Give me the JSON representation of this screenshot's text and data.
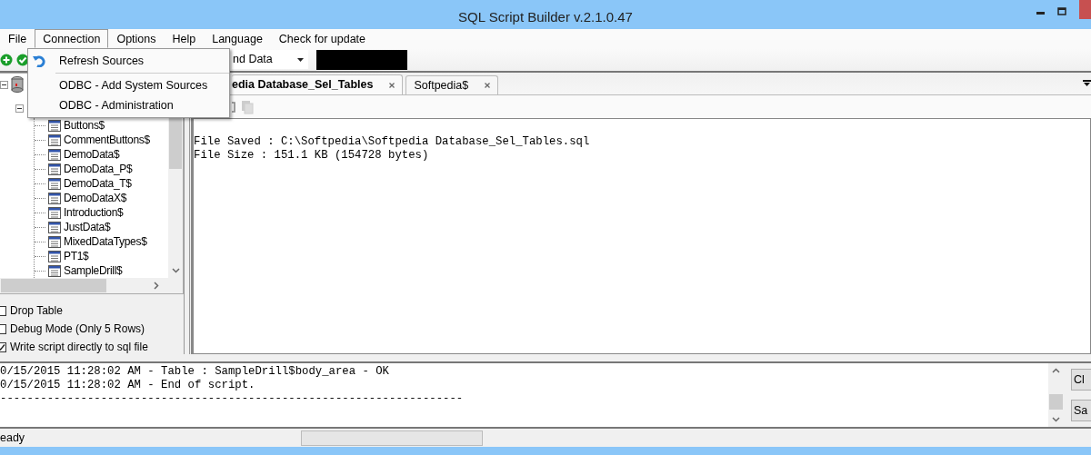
{
  "window": {
    "title": "SQL Script Builder v.2.1.0.47"
  },
  "menu": [
    {
      "label": "File",
      "selected": false
    },
    {
      "label": "Connection",
      "selected": true
    },
    {
      "label": "Options",
      "selected": false
    },
    {
      "label": "Help",
      "selected": false
    },
    {
      "label": "Language",
      "selected": false
    },
    {
      "label": "Check for update",
      "selected": false
    }
  ],
  "connection_menu": [
    {
      "kind": "icon_item",
      "label": "Refresh Sources"
    },
    {
      "kind": "separator"
    },
    {
      "kind": "item",
      "label": "ODBC - Add System Sources"
    },
    {
      "kind": "item",
      "label": "ODBC - Administration"
    }
  ],
  "toolbar": {
    "combo_value": "nd Data"
  },
  "tree": {
    "expanded": true,
    "children": [
      {
        "expanded": true,
        "children": [
          {
            "label": "Buttons$"
          },
          {
            "label": "CommentButtons$"
          },
          {
            "label": "DemoData$"
          },
          {
            "label": "DemoData_P$"
          },
          {
            "label": "DemoData_T$"
          },
          {
            "label": "DemoDataX$"
          },
          {
            "label": "Introduction$"
          },
          {
            "label": "JustData$"
          },
          {
            "label": "MixedDataTypes$"
          },
          {
            "label": "PT1$"
          },
          {
            "label": "SampleDrill$"
          }
        ]
      }
    ]
  },
  "options": [
    {
      "label": "Drop Table",
      "checked": false
    },
    {
      "label": "Debug Mode (Only 5 Rows)",
      "checked": false
    },
    {
      "label": "Write script directly to sql file",
      "checked": true
    }
  ],
  "tabs": [
    {
      "label": "edia Database_Sel_Tables",
      "selected": true
    },
    {
      "label": "Softpedia$",
      "selected": false
    }
  ],
  "editor": {
    "lines": [
      "File Saved : C:\\Softpedia\\Softpedia Database_Sel_Tables.sql",
      "File Size : 151.1 KB (154728 bytes)"
    ]
  },
  "log": {
    "lines": [
      "0/15/2015 11:28:02 AM - Table : SampleDrill$body_area - OK",
      "0/15/2015 11:28:02 AM - End of script.",
      "---------------------------------------------------------------------"
    ]
  },
  "side_buttons": [
    "Cl",
    "Sa"
  ],
  "status_bar": {
    "text": "eady",
    "progress": {
      "level": 0
    }
  }
}
